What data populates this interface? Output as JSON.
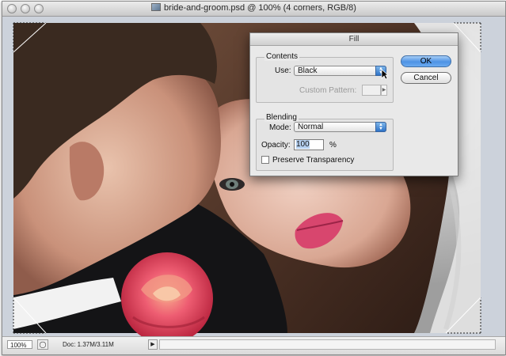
{
  "window": {
    "title": "bride-and-groom.psd @ 100% (4 corners, RGB/8)"
  },
  "statusbar": {
    "zoom": "100%",
    "doc_info": "Doc: 1.37M/3.11M"
  },
  "dialog": {
    "title": "Fill",
    "contents_group": "Contents",
    "use_label": "Use:",
    "use_value": "Black",
    "custom_pattern_label": "Custom Pattern:",
    "blending_group": "Blending",
    "mode_label": "Mode:",
    "mode_value": "Normal",
    "opacity_label": "Opacity:",
    "opacity_value": "100",
    "opacity_unit": "%",
    "preserve_label": "Preserve Transparency",
    "preserve_checked": false,
    "ok_label": "OK",
    "cancel_label": "Cancel"
  },
  "colors": {
    "ok_button": "#4d93e4",
    "popup_arrow": "#2e73c7",
    "canvas_background": "#ccd2db"
  }
}
